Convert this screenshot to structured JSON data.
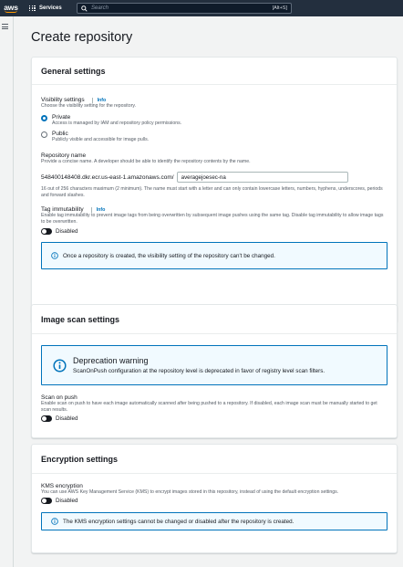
{
  "nav": {
    "logo": "aws",
    "services_label": "Services",
    "search_placeholder": "Search",
    "search_shortcut": "[Alt+S]"
  },
  "page": {
    "title": "Create repository"
  },
  "general": {
    "title": "General settings",
    "visibility_label": "Visibility settings",
    "info": "Info",
    "visibility_desc": "Choose the visibility setting for the repository.",
    "private_label": "Private",
    "private_desc": "Access is managed by IAM and repository policy permissions.",
    "public_label": "Public",
    "public_desc": "Publicly visible and accessible for image pulls.",
    "selected": "Private",
    "repo_name_label": "Repository name",
    "repo_name_desc": "Provide a concise name. A developer should be able to identify the repository contents by the name.",
    "repo_prefix": "548400148408.dkr.ecr.us-east-1.amazonaws.com/",
    "repo_value": "averagejoesec-na",
    "repo_hint": "16 out of 256 characters maximum (2 minimum). The name must start with a letter and can only contain lowercase letters, numbers, hyphens, underscores, periods and forward slashes.",
    "tag_label": "Tag immutability",
    "tag_desc": "Enable tag immutability to prevent image tags from being overwritten by subsequent image pushes using the same tag. Disable tag immutability to allow image tags to be overwritten.",
    "tag_state": "Disabled",
    "alert": "Once a repository is created, the visibility setting of the repository can't be changed."
  },
  "scan": {
    "title": "Image scan settings",
    "warn_title": "Deprecation warning",
    "warn_text": "ScanOnPush configuration at the repository level is deprecated in favor of registry level scan filters.",
    "push_label": "Scan on push",
    "push_desc": "Enable scan on push to have each image automatically scanned after being pushed to a repository. If disabled, each image scan must be manually started to get scan results.",
    "push_state": "Disabled"
  },
  "encryption": {
    "title": "Encryption settings",
    "kms_label": "KMS encryption",
    "kms_desc": "You can use AWS Key Management Service (KMS) to encrypt images stored in this repository, instead of using the default encryption settings.",
    "kms_state": "Disabled",
    "alert": "The KMS encryption settings cannot be changed or disabled after the repository is created."
  },
  "colors": {
    "accent": "#0073bb",
    "nav": "#232f3e",
    "brand": "#ff9900"
  }
}
